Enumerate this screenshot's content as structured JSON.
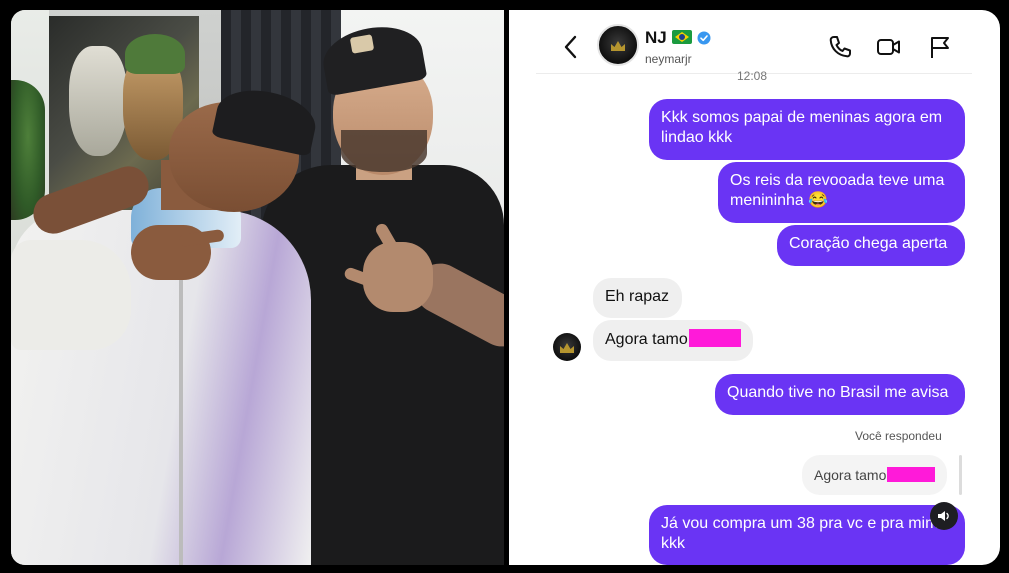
{
  "contact": {
    "name": "NJ",
    "username": "neymarjr"
  },
  "chat": {
    "timestamp": "12:08",
    "messages": [
      {
        "from": "me",
        "text": "Kkk somos papai de meninas agora em lindao kkk"
      },
      {
        "from": "me",
        "text": "Os reis da revooada teve uma menininha 😂"
      },
      {
        "from": "me",
        "text": "Coração chega aperta"
      },
      {
        "from": "them",
        "text": "Eh rapaz"
      },
      {
        "from": "them",
        "text": "Agora tamo"
      },
      {
        "from": "me",
        "text": "Quando tive no Brasil me avisa"
      },
      {
        "from": "me",
        "text": "Já vou compra um 38 pra vc e pra mim kkk",
        "reply_to": "Agora tamo"
      }
    ],
    "reply_label": "Você respondeu"
  },
  "icons": {
    "back": "chevron-left-icon",
    "verified": "verified-badge-icon",
    "flag": "brazil-flag-icon",
    "call": "phone-icon",
    "video": "video-camera-icon",
    "report": "flag-icon",
    "audio": "speaker-icon"
  },
  "colors": {
    "outgoing_bubble": "#6a34f4",
    "incoming_bubble": "#efefef",
    "verified": "#3897f0",
    "redaction": "#ff1ad9"
  }
}
